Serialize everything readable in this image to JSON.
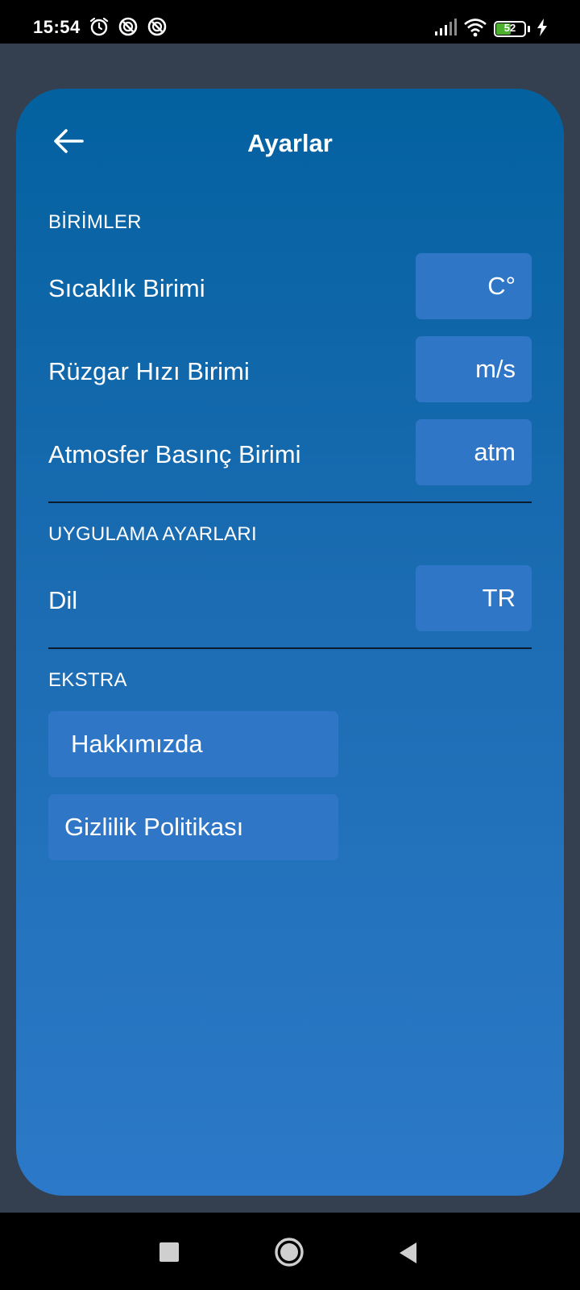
{
  "status_bar": {
    "time": "15:54",
    "battery_level": "52",
    "battery_fraction": 0.52,
    "icons": [
      "alarm-icon",
      "do-not-disturb-icon",
      "do-not-disturb-icon",
      "signal-icon",
      "wifi-icon",
      "battery-icon",
      "charging-icon"
    ]
  },
  "header": {
    "title": "Ayarlar",
    "back_icon": "arrow-left-icon"
  },
  "sections": {
    "units": {
      "title": "BİRİMLER",
      "items": [
        {
          "label": "Sıcaklık Birimi",
          "value": "C°"
        },
        {
          "label": "Rüzgar Hızı Birimi",
          "value": "m/s"
        },
        {
          "label": "Atmosfer Basınç Birimi",
          "value": "atm"
        }
      ]
    },
    "app_settings": {
      "title": "UYGULAMA AYARLARI",
      "items": [
        {
          "label": "Dil",
          "value": "TR"
        }
      ]
    },
    "extra": {
      "title": "EKSTRA",
      "buttons": [
        {
          "label": "Hakkımızda"
        },
        {
          "label": "Gizlilik Politikası"
        }
      ]
    }
  },
  "colors": {
    "card_top": "#0361a0",
    "card_bottom": "#2b79c8",
    "value_box": "#2f76c6",
    "background": "#34404f",
    "divider": "#0c1b2c"
  },
  "nav_bar": {
    "icons": [
      "recents-square-icon",
      "home-circle-icon",
      "back-triangle-icon"
    ]
  }
}
